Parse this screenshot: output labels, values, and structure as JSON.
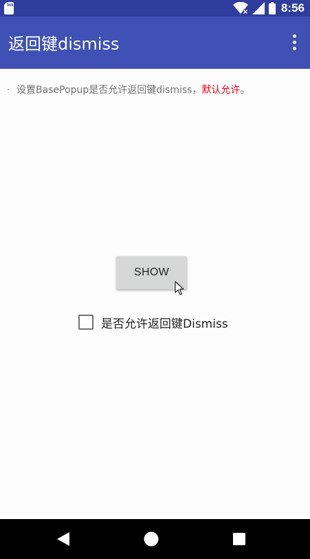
{
  "status_bar": {
    "time": "8:56",
    "icons": [
      "sd-card-icon",
      "wifi-icon",
      "signal-icon",
      "battery-icon"
    ]
  },
  "app_bar": {
    "title": "返回键dismiss",
    "menu_icon": "overflow-menu-icon"
  },
  "content": {
    "description_prefix": "设置BasePopup是否允许返回键dismiss，",
    "description_highlight": "默认允许",
    "description_suffix": "。",
    "highlight_color": "#e60012",
    "show_button_label": "SHOW",
    "checkbox": {
      "label": "是否允许返回键Dismiss",
      "checked": false
    }
  },
  "nav_bar": {
    "buttons": [
      "back-icon",
      "home-icon",
      "recents-icon"
    ]
  },
  "colors": {
    "status_bar": "#2f3e9e",
    "app_bar": "#3f51b5",
    "background": "#fdfdfd",
    "button": "#d6d7d7",
    "nav_bar": "#000000"
  }
}
